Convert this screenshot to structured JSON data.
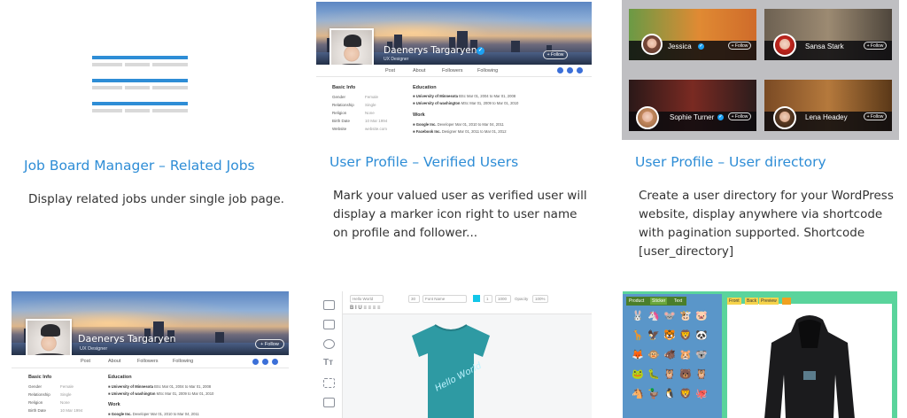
{
  "cards": [
    {
      "title": "Job Board Manager – Related Jobs",
      "desc": "Display related jobs under single job page."
    },
    {
      "title": "User Profile – Verified Users",
      "desc": "Mark your valued user as verified user will display a marker icon right to user name on profile and follower..."
    },
    {
      "title": "User Profile – User directory",
      "desc": "Create a user directory for your WordPress website, display anywhere via shortcode with pagination supported. Shortcode [user_directory]"
    }
  ],
  "profile": {
    "name": "Daenerys Targaryen",
    "role": "UX Designer",
    "follow_label": "Follow",
    "nav": [
      "Post",
      "About",
      "Followers",
      "Following"
    ],
    "basic_info_title": "Basic Info",
    "info": [
      {
        "key": "Gender",
        "value": "Female"
      },
      {
        "key": "Relationship",
        "value": "Single"
      },
      {
        "key": "Religion",
        "value": "None"
      },
      {
        "key": "Birth Date",
        "value": "10 Mar 1994"
      },
      {
        "key": "Website",
        "value": "website.com"
      }
    ],
    "education_title": "Education",
    "education": [
      {
        "org": "University of Minnesota",
        "detail": "BSc Mar 01, 2004 to Mar 01, 2008"
      },
      {
        "org": "University of washington",
        "detail": "MSc Mar 01, 2009 to Mar 01, 2010"
      }
    ],
    "work_title": "Work",
    "work": [
      {
        "org": "Google Inc.",
        "detail": "Developer Mar 01, 2010 to Mar 04, 2011"
      },
      {
        "org": "Facebook Inc.",
        "detail": "Designer Mar 01, 2011 to Mar 01, 2012"
      }
    ]
  },
  "directory": {
    "follow_label": "Follow",
    "users": [
      {
        "name": "Jessica"
      },
      {
        "name": "Sansa Stark"
      },
      {
        "name": "Sophie Turner"
      },
      {
        "name": "Lena Headey"
      }
    ]
  },
  "designer": {
    "inputs": [
      "Hello World",
      "30",
      "Font Name",
      "1",
      "1000",
      "Opacity",
      "100%"
    ],
    "shirt_text": "Hello World",
    "colors": {
      "shirt": "#2e9aa3",
      "accent": "#12c6e8"
    }
  },
  "sticker": {
    "tabs": [
      "Product",
      "Sticker",
      "Text"
    ],
    "canvas_tabs": [
      "Front",
      "Back",
      "Preview"
    ]
  }
}
